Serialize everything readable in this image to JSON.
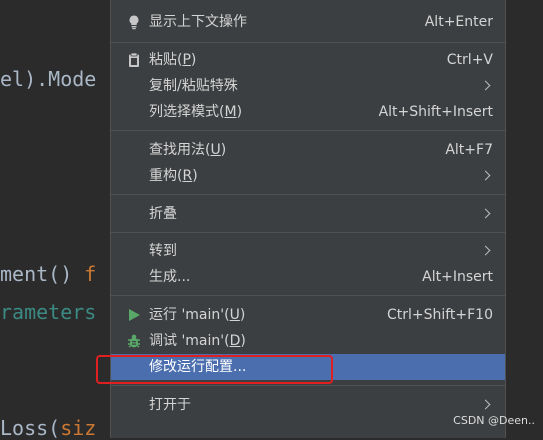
{
  "code": {
    "line1": "el).Mode",
    "line2_main": "ment() ",
    "line2_kw": "f",
    "line3": "rameters",
    "line4_main": "Loss(",
    "line4_kw": "siz"
  },
  "menu": {
    "items": [
      {
        "label": "显示上下文操作",
        "shortcut": "Alt+Enter",
        "icon": "lightbulb-icon"
      },
      {
        "label": "粘贴(",
        "mnemonic": "P",
        "after": ")",
        "shortcut": "Ctrl+V",
        "icon": "clipboard-icon"
      },
      {
        "label": "复制/粘贴特殊",
        "submenu": true
      },
      {
        "label": "列选择模式(",
        "mnemonic": "M",
        "after": ")",
        "shortcut": "Alt+Shift+Insert"
      },
      {
        "label": "查找用法(",
        "mnemonic": "U",
        "after": ")",
        "shortcut": "Alt+F7"
      },
      {
        "label": "重构(",
        "mnemonic": "R",
        "after": ")",
        "submenu": true
      },
      {
        "label": "折叠",
        "submenu": true
      },
      {
        "label": "转到",
        "submenu": true
      },
      {
        "label": "生成...",
        "shortcut": "Alt+Insert"
      },
      {
        "label": "运行 'main'(",
        "mnemonic": "U",
        "after": ")",
        "shortcut": "Ctrl+Shift+F10",
        "icon": "run-icon"
      },
      {
        "label": "调试 'main'(",
        "mnemonic": "D",
        "after": ")",
        "icon": "debug-bug-icon"
      },
      {
        "label": "修改运行配置...",
        "highlighted": true
      },
      {
        "label": "打开于",
        "submenu": true
      }
    ]
  },
  "watermark": "CSDN @Deen.."
}
